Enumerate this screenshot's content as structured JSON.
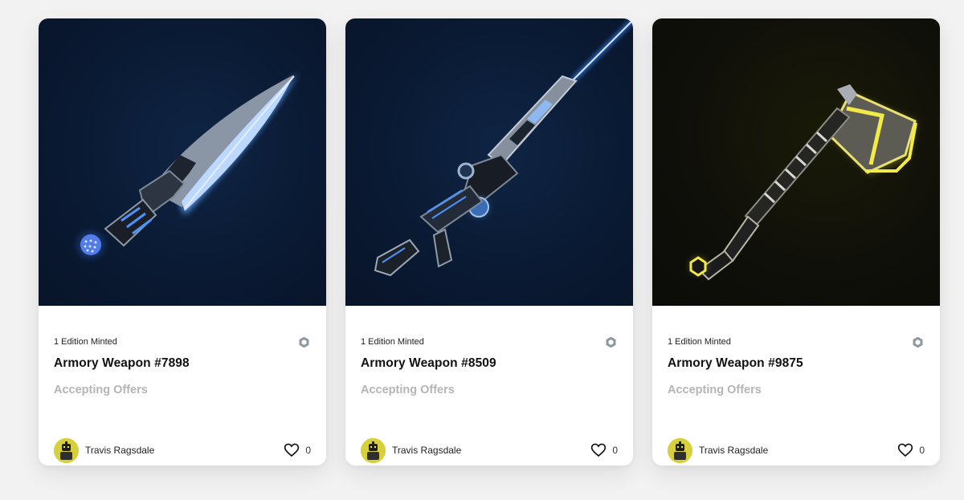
{
  "cards": [
    {
      "edition": "1 Edition Minted",
      "title": "Armory Weapon #7898",
      "status": "Accepting Offers",
      "creator": "Travis Ragsdale",
      "likes": "0",
      "image_icon": "blue-glowing-blade-icon"
    },
    {
      "edition": "1 Edition Minted",
      "title": "Armory Weapon #8509",
      "status": "Accepting Offers",
      "creator": "Travis Ragsdale",
      "likes": "0",
      "image_icon": "blue-laser-rifle-icon"
    },
    {
      "edition": "1 Edition Minted",
      "title": "Armory Weapon #9875",
      "status": "Accepting Offers",
      "creator": "Travis Ragsdale",
      "likes": "0",
      "image_icon": "yellow-glowing-axe-icon"
    }
  ],
  "icons": {
    "chain": "hexagon-chain-icon",
    "like": "heart-icon"
  },
  "colors": {
    "page_background": "#f2f2f2",
    "card_background": "#ffffff",
    "status_text": "#b5b5b5",
    "blue_glow": "#3f8bff",
    "yellow_glow": "#f2ea48"
  }
}
